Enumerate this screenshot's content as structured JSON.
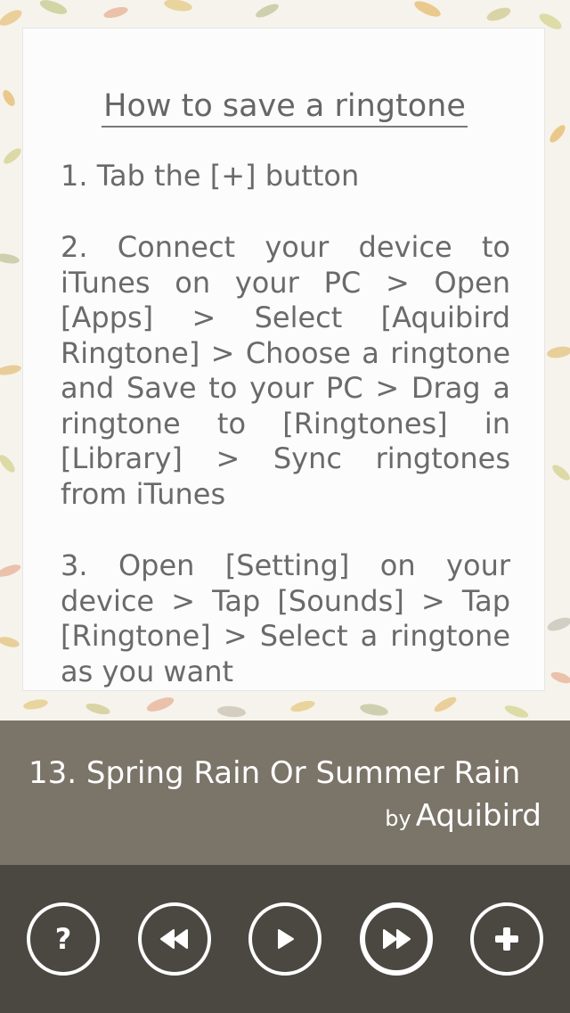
{
  "help": {
    "title": "How to save a ringtone",
    "step1": "1. Tab the [+] button",
    "step2": "2. Connect your device to iTunes on your PC > Open [Apps] > Select [Aquibird Ringtone] > Choose a ringtone and Save to your PC > Drag a ringtone to [Ringtones] in [Library] > Sync ringtones from iTunes",
    "step3": "3. Open [Setting] on your device > Tap [Sounds] > Tap [Ringtone] > Select a ringtone as you want"
  },
  "now_playing": {
    "title": "13. Spring Rain Or Summer Rain",
    "by_label": "by",
    "artist": "Aquibird"
  },
  "controls": [
    {
      "icon": "help-icon"
    },
    {
      "icon": "rewind-icon"
    },
    {
      "icon": "play-icon"
    },
    {
      "icon": "fast-forward-icon"
    },
    {
      "icon": "plus-icon"
    }
  ],
  "colors": {
    "bar": "#5f584c",
    "controls_bg": "#4b4842",
    "text_gray": "#6a6a6a",
    "icon_white": "#ffffff"
  }
}
